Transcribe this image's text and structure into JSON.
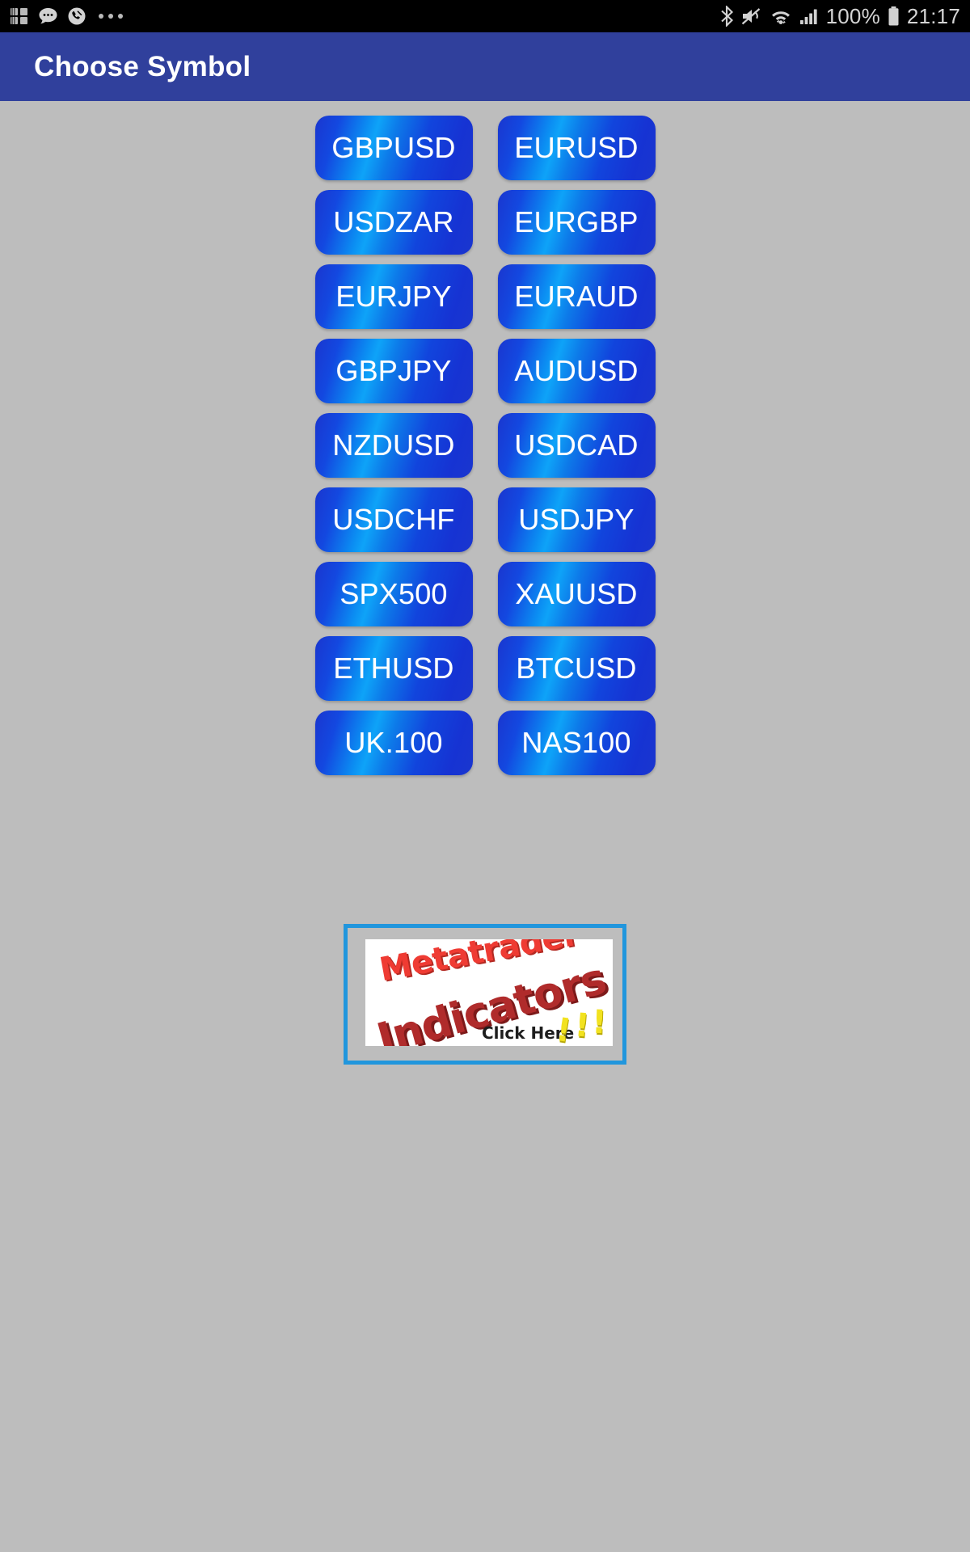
{
  "status_bar": {
    "time": "21:17",
    "battery_percent": "100%",
    "left_icons": [
      "app-grid-icon",
      "message-bubble-icon",
      "missed-call-icon",
      "more-dots-icon"
    ],
    "right_icons": [
      "bluetooth-icon",
      "mute-icon",
      "wifi-icon",
      "cellular-signal-icon",
      "battery-icon"
    ]
  },
  "app_bar": {
    "title": "Choose Symbol",
    "color": "#30409c"
  },
  "theme": {
    "background": "#bdbdbd",
    "button_edge_blue": "#1a36cf",
    "button_center_blue": "#0ea3f8",
    "button_text": "#ffffff",
    "ad_border": "#2196dd"
  },
  "symbols": {
    "column_left": [
      "GBPUSD",
      "USDZAR",
      "EURJPY",
      "GBPJPY",
      "NZDUSD",
      "USDCHF",
      "SPX500",
      "ETHUSD",
      "UK.100"
    ],
    "column_right": [
      "EURUSD",
      "EURGBP",
      "EURAUD",
      "AUDUSD",
      "USDCAD",
      "USDJPY",
      "XAUUSD",
      "BTCUSD",
      "NAS100"
    ]
  },
  "ad_banner": {
    "line1": "Metatrader",
    "line2": "Indicators",
    "cta": "Click Here",
    "exclamations": [
      "!",
      "!",
      "!"
    ]
  }
}
